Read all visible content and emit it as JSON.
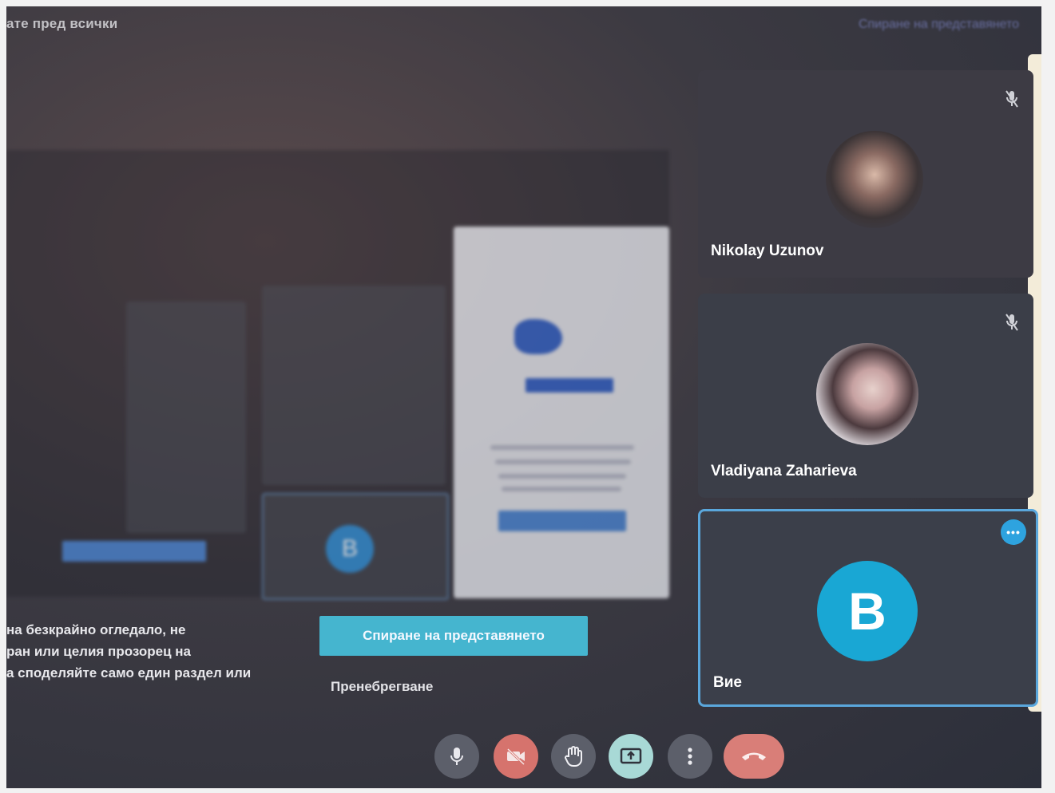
{
  "top_bar": {
    "left_text": "ате пред всички",
    "right_link": "Спиране на представянето"
  },
  "participants": [
    {
      "name": "Nikolay Uzunov",
      "muted": true,
      "avatar": "photo"
    },
    {
      "name": "Vladiyana Zaharieva",
      "muted": true,
      "avatar": "photo"
    },
    {
      "name": "Вие",
      "avatar_letter": "B",
      "avatar_color": "#19a7d4",
      "self": true
    }
  ],
  "warning_lines": [
    "на безкрайно огледало, не",
    "ран или целия прозорец на",
    "а споделяйте само един раздел или"
  ],
  "stop_button_label": "Спиране на представянето",
  "ignore_link_label": "Пренебрегване",
  "controls": [
    {
      "name": "microphone-icon"
    },
    {
      "name": "camera-off-icon",
      "color": "#d6736d"
    },
    {
      "name": "raise-hand-icon"
    },
    {
      "name": "present-screen-icon",
      "color": "#a8d9d6"
    },
    {
      "name": "more-options-icon"
    },
    {
      "name": "end-call-icon",
      "color": "#d97e78"
    }
  ]
}
